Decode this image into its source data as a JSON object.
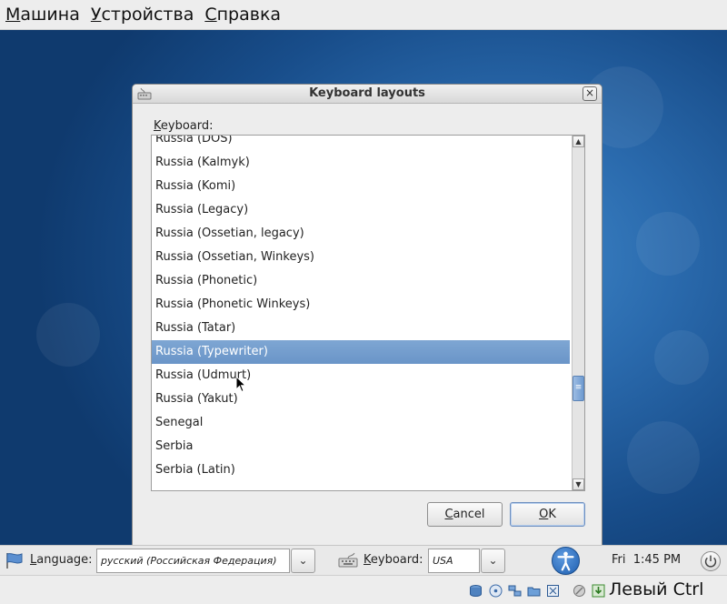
{
  "vm_menubar": {
    "items": [
      "Машина",
      "Устройства",
      "Справка"
    ]
  },
  "dialog": {
    "title": "Keyboard layouts",
    "keyboard_label": "Keyboard:",
    "items": [
      "Russia (DOS)",
      "Russia (Kalmyk)",
      "Russia (Komi)",
      "Russia (Legacy)",
      "Russia (Ossetian, legacy)",
      "Russia (Ossetian, Winkeys)",
      "Russia (Phonetic)",
      "Russia (Phonetic Winkeys)",
      "Russia (Tatar)",
      "Russia (Typewriter)",
      "Russia (Udmurt)",
      "Russia (Yakut)",
      "Senegal",
      "Serbia",
      "Serbia (Latin)"
    ],
    "selected_index": 9,
    "cancel_label": "Cancel",
    "ok_label": "OK"
  },
  "installer_bar": {
    "language_label": "Language:",
    "language_value": "русский (Российская Федерация)",
    "keyboard_label": "Keyboard:",
    "keyboard_value": "USA",
    "clock": "Fri  1:45 PM"
  },
  "vm_statusbar": {
    "host_key": "Левый Ctrl"
  },
  "colors": {
    "selection": "#6a95c8",
    "desktop": "#1f5a9c"
  }
}
